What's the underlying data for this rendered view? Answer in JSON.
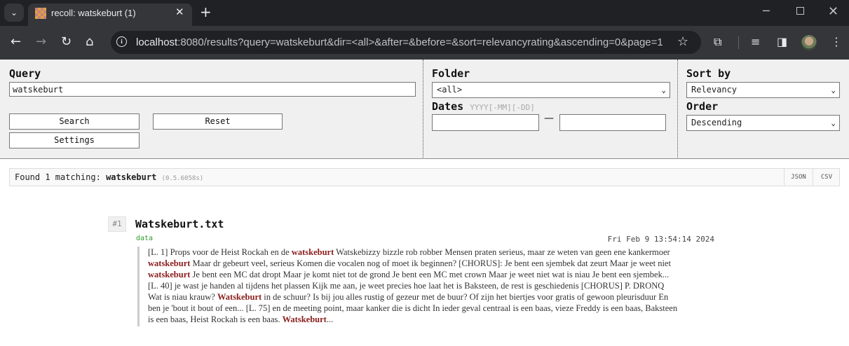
{
  "browser": {
    "tab_title": "recoll: watskeburt (1)",
    "url_host": "localhost",
    "url_rest": ":8080/results?query=watskeburt&dir=<all>&after=&before=&sort=relevancyrating&ascending=0&page=1"
  },
  "search": {
    "query_label": "Query",
    "query_value": "watskeburt",
    "search_button": "Search",
    "reset_button": "Reset",
    "settings_button": "Settings",
    "folder_label": "Folder",
    "folder_value": "<all>",
    "dates_label": "Dates",
    "dates_hint": "YYYY[-MM][-DD]",
    "date_separator": "—",
    "date_after": "",
    "date_before": "",
    "sort_label": "Sort by",
    "sort_value": "Relevancy",
    "order_label": "Order",
    "order_value": "Descending"
  },
  "results_summary": {
    "prefix": "Found 1 matching:",
    "term": "watskeburt",
    "time": "(0.5.6058s)",
    "json_label": "JSON",
    "csv_label": "CSV"
  },
  "results": [
    {
      "rank": "#1",
      "title": "Watskeburt.txt",
      "link_label": "data",
      "date": "Fri Feb 9 13:54:14 2024",
      "snippet_lines": [
        [
          {
            "t": "[L. 1] Props voor de Heist Rockah en de "
          },
          {
            "t": "watskeburt",
            "hl": true
          },
          {
            "t": " Watskebizzy bizzle rob robber Mensen praten serieus, maar ze weten van geen ene kankermoer"
          }
        ],
        [
          {
            "t": "watskeburt",
            "hl": true
          },
          {
            "t": " Maar dr gebeurt veel, serieus Komen die vocalen nog of moet ik beginnen? [CHORUS]: Je bent een sjembek dat zeurt Maar je weet niet"
          }
        ],
        [
          {
            "t": "watskeburt",
            "hl": true
          },
          {
            "t": " Je bent een MC dat dropt Maar je komt niet tot de grond Je bent een MC met crown Maar je weet niet wat is niau Je bent een sjembek..."
          }
        ],
        [
          {
            "t": "[L. 40] je wast je handen al tijdens het plassen Kijk me aan, je weet precies hoe laat het is Baksteen, de rest is geschiedenis [CHORUS] P. DRONQ"
          }
        ],
        [
          {
            "t": "Wat is niau krauw? "
          },
          {
            "t": "Watskeburt",
            "hl": true
          },
          {
            "t": " in de schuur? Is bij jou alles rustig of gezeur met de buur? Of zijn het biertjes voor gratis of gewoon pleurisduur En"
          }
        ],
        [
          {
            "t": "ben je 'bout it bout of een... [L. 75] en de meeting point, maar kanker die is dicht In ieder geval centraal is een baas, vieze Freddy is een baas, Baksteen"
          }
        ],
        [
          {
            "t": "is een baas, Heist Rockah is een baas. "
          },
          {
            "t": "Watskeburt",
            "hl": true
          },
          {
            "t": "..."
          }
        ]
      ]
    }
  ]
}
